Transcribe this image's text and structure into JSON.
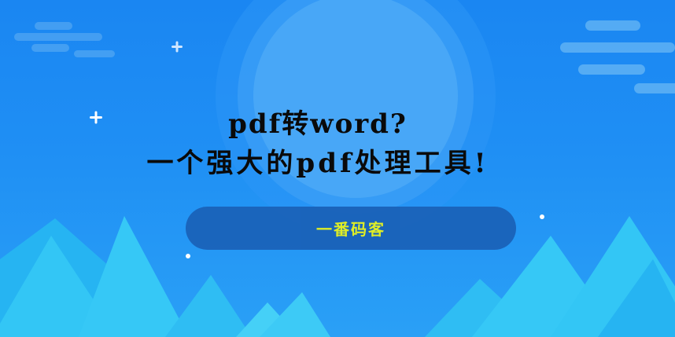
{
  "banner": {
    "title_line1": "pdf转word?",
    "title_line2": "一个强大的pdf处理工具!",
    "pill_label": "一番码客"
  },
  "colors": {
    "background_top": "#1a86f2",
    "background_bottom": "#2aa0f6",
    "circle": "#4ba9f7",
    "mountain_light": "#33c6f5",
    "mountain_mid": "#1fb3f0",
    "pill": "#1a62b8",
    "pill_text": "#e8f21c",
    "title_text": "#0a0a0a"
  }
}
